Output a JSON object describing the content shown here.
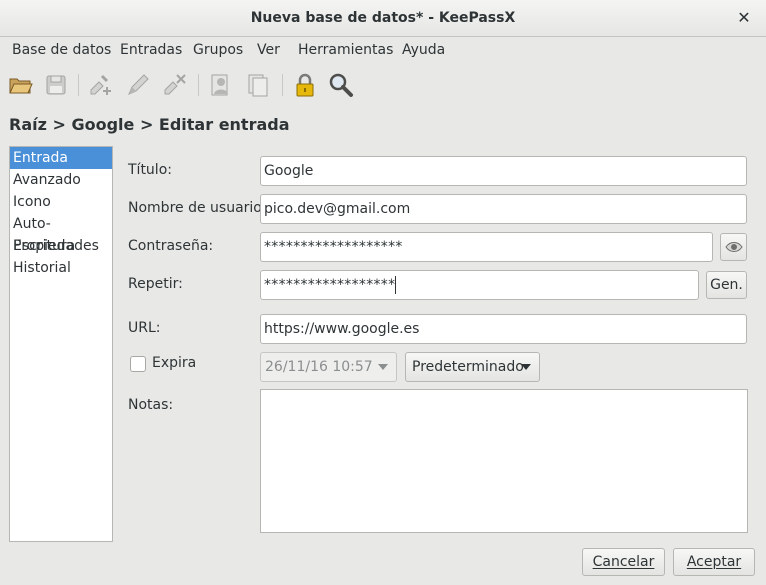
{
  "window": {
    "title": "Nueva base de datos* - KeePassX",
    "close_glyph": "✕"
  },
  "menu": [
    "Base de datos",
    "Entradas",
    "Grupos",
    "Ver",
    "Herramientas",
    "Ayuda"
  ],
  "toolbar": {
    "icons": [
      "open-folder-icon",
      "save-disk-icon",
      "add-entry-icon",
      "edit-entry-icon",
      "delete-entry-icon",
      "copy-username-icon",
      "copy-password-icon",
      "lock-icon",
      "search-icon"
    ]
  },
  "breadcrumb": "Raíz > Google > Editar entrada",
  "sidebar": {
    "items": [
      "Entrada",
      "Avanzado",
      "Icono",
      "Auto-Escritura",
      "Propiedades",
      "Historial"
    ],
    "selected": "Entrada"
  },
  "form": {
    "title_label": "Título:",
    "title_value": "Google",
    "username_label": "Nombre de usuario:",
    "username_value": "pico.dev@gmail.com",
    "password_label": "Contraseña:",
    "password_value": "*******************",
    "repeat_label": "Repetir:",
    "repeat_value": "******************",
    "gen_label": "Gen.",
    "url_label": "URL:",
    "url_value": "https://www.google.es",
    "expires_label": "Expira",
    "expires_checked": false,
    "expiry_date": "26/11/16 10:57",
    "preset_label": "Predeterminado",
    "notes_label": "Notas:"
  },
  "buttons": {
    "cancel_label": "Cancelar",
    "accept_label": "Aceptar"
  },
  "colors": {
    "selection": "#4a90d9",
    "lock": "#e5b80b"
  }
}
